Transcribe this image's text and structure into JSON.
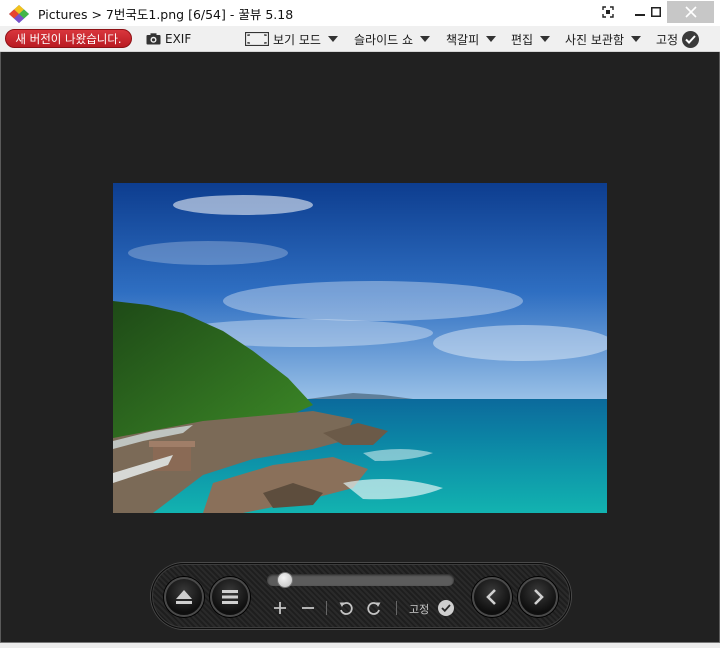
{
  "window": {
    "title": "Pictures > 7번국도1.png [6/54] - 꿀뷰 5.18"
  },
  "toolbar": {
    "update_badge": "새 버전이 나왔습니다.",
    "exif_label": "EXIF",
    "view_mode_label": "보기 모드",
    "slideshow_label": "슬라이드 쇼",
    "bookmark_label": "책갈피",
    "edit_label": "편집",
    "photo_box_label": "사진 보관함",
    "fix_label": "고정"
  },
  "controls": {
    "fix_label": "고정",
    "progress": 0.06
  },
  "colors": {
    "viewer_bg": "#212121",
    "update_badge_bg": "#c8262d",
    "toolbar_bg": "#f0f0f0"
  },
  "icons": [
    "app-logo-icon",
    "capture-icon",
    "minimize-icon",
    "maximize-icon",
    "close-icon",
    "camera-icon",
    "view-mode-icon",
    "dropdown-arrow-icon",
    "check-icon",
    "eject-icon",
    "menu-icon",
    "zoom-in-icon",
    "zoom-out-icon",
    "rotate-left-icon",
    "rotate-right-icon",
    "prev-icon",
    "next-icon"
  ]
}
